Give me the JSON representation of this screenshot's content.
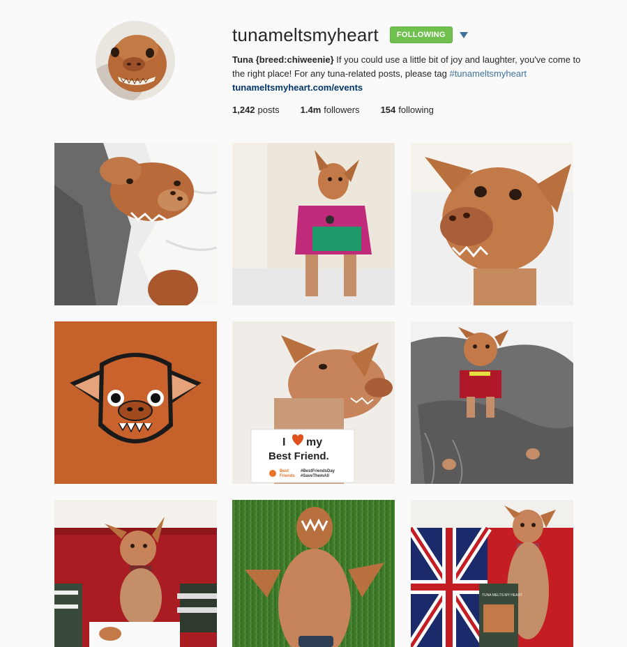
{
  "profile": {
    "username": "tunameltsmyheart",
    "follow_button": "FOLLOWING",
    "bio_name": "Tuna {breed:chiweenie}",
    "bio_text": " If you could use a little bit of joy and laughter, you've come to the right place! For any tuna-related posts, please tag ",
    "bio_hashtag": "#tunameltsmyheart",
    "website": "tunameltsmyheart.com/events",
    "stats": {
      "posts_count": "1,242",
      "posts_label": "posts",
      "followers_count": "1.4m",
      "followers_label": "followers",
      "following_count": "154",
      "following_label": "following"
    }
  },
  "posts": {
    "best_friend_card": {
      "line1": "I",
      "line1b": "my",
      "line2": "Best Friend.",
      "org1": "Best",
      "org2": "Friends",
      "tag1": "#BestFriendsDay",
      "tag2": "#SaveThemAll"
    },
    "book_title": "TUNA MELTS MY HEART"
  },
  "colors": {
    "follow_green": "#70c050",
    "link_blue": "#003569",
    "hashtag_blue": "#3f729b",
    "background": "#fafafa"
  }
}
